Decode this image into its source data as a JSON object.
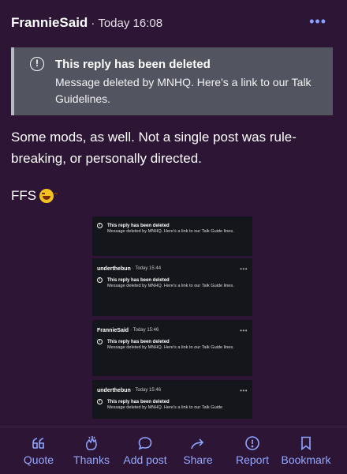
{
  "post": {
    "author": "FrannieSaid",
    "separator": "·",
    "time": "Today 16:08",
    "more": "•••"
  },
  "deleted_notice": {
    "title": "This reply has been deleted",
    "message": "Message deleted by MNHQ. Here's a link to our Talk Guidelines."
  },
  "body": {
    "paragraph": "Some mods, as well. Not a single post was rule-breaking, or personally directed.",
    "ffs": "FFS"
  },
  "embedded_screenshot": {
    "cards": [
      {
        "author": "",
        "time": "",
        "title": "This reply has been deleted",
        "message": "Message deleted by MNHQ. Here's a link to our Talk Guide lines."
      },
      {
        "author": "underthebun",
        "time": "· Today 15:44",
        "title": "This reply has been deleted",
        "message": "Message deleted by MNHQ. Here's a link to our Talk Guide lines."
      },
      {
        "author": "FrannieSaid",
        "time": "· Today 15:46",
        "title": "This reply has been deleted",
        "message": "Message deleted by MNHQ. Here's a link to our Talk Guide lines."
      },
      {
        "author": "underthebun",
        "time": "· Today 15:46",
        "title": "This reply has been deleted",
        "message": "Message deleted by MNHQ. Here's a link to our Talk Guide"
      }
    ],
    "more": "•••"
  },
  "actions": [
    {
      "label": "Quote",
      "icon": "quote-icon"
    },
    {
      "label": "Thanks",
      "icon": "clap-icon"
    },
    {
      "label": "Add post",
      "icon": "speech-bubble-icon"
    },
    {
      "label": "Share",
      "icon": "share-arrow-icon"
    },
    {
      "label": "Report",
      "icon": "alert-circle-icon"
    },
    {
      "label": "Bookmark",
      "icon": "bookmark-icon"
    }
  ],
  "colors": {
    "background": "#2c1535",
    "notice_bg": "#525560",
    "accent": "#8ea6ff"
  }
}
